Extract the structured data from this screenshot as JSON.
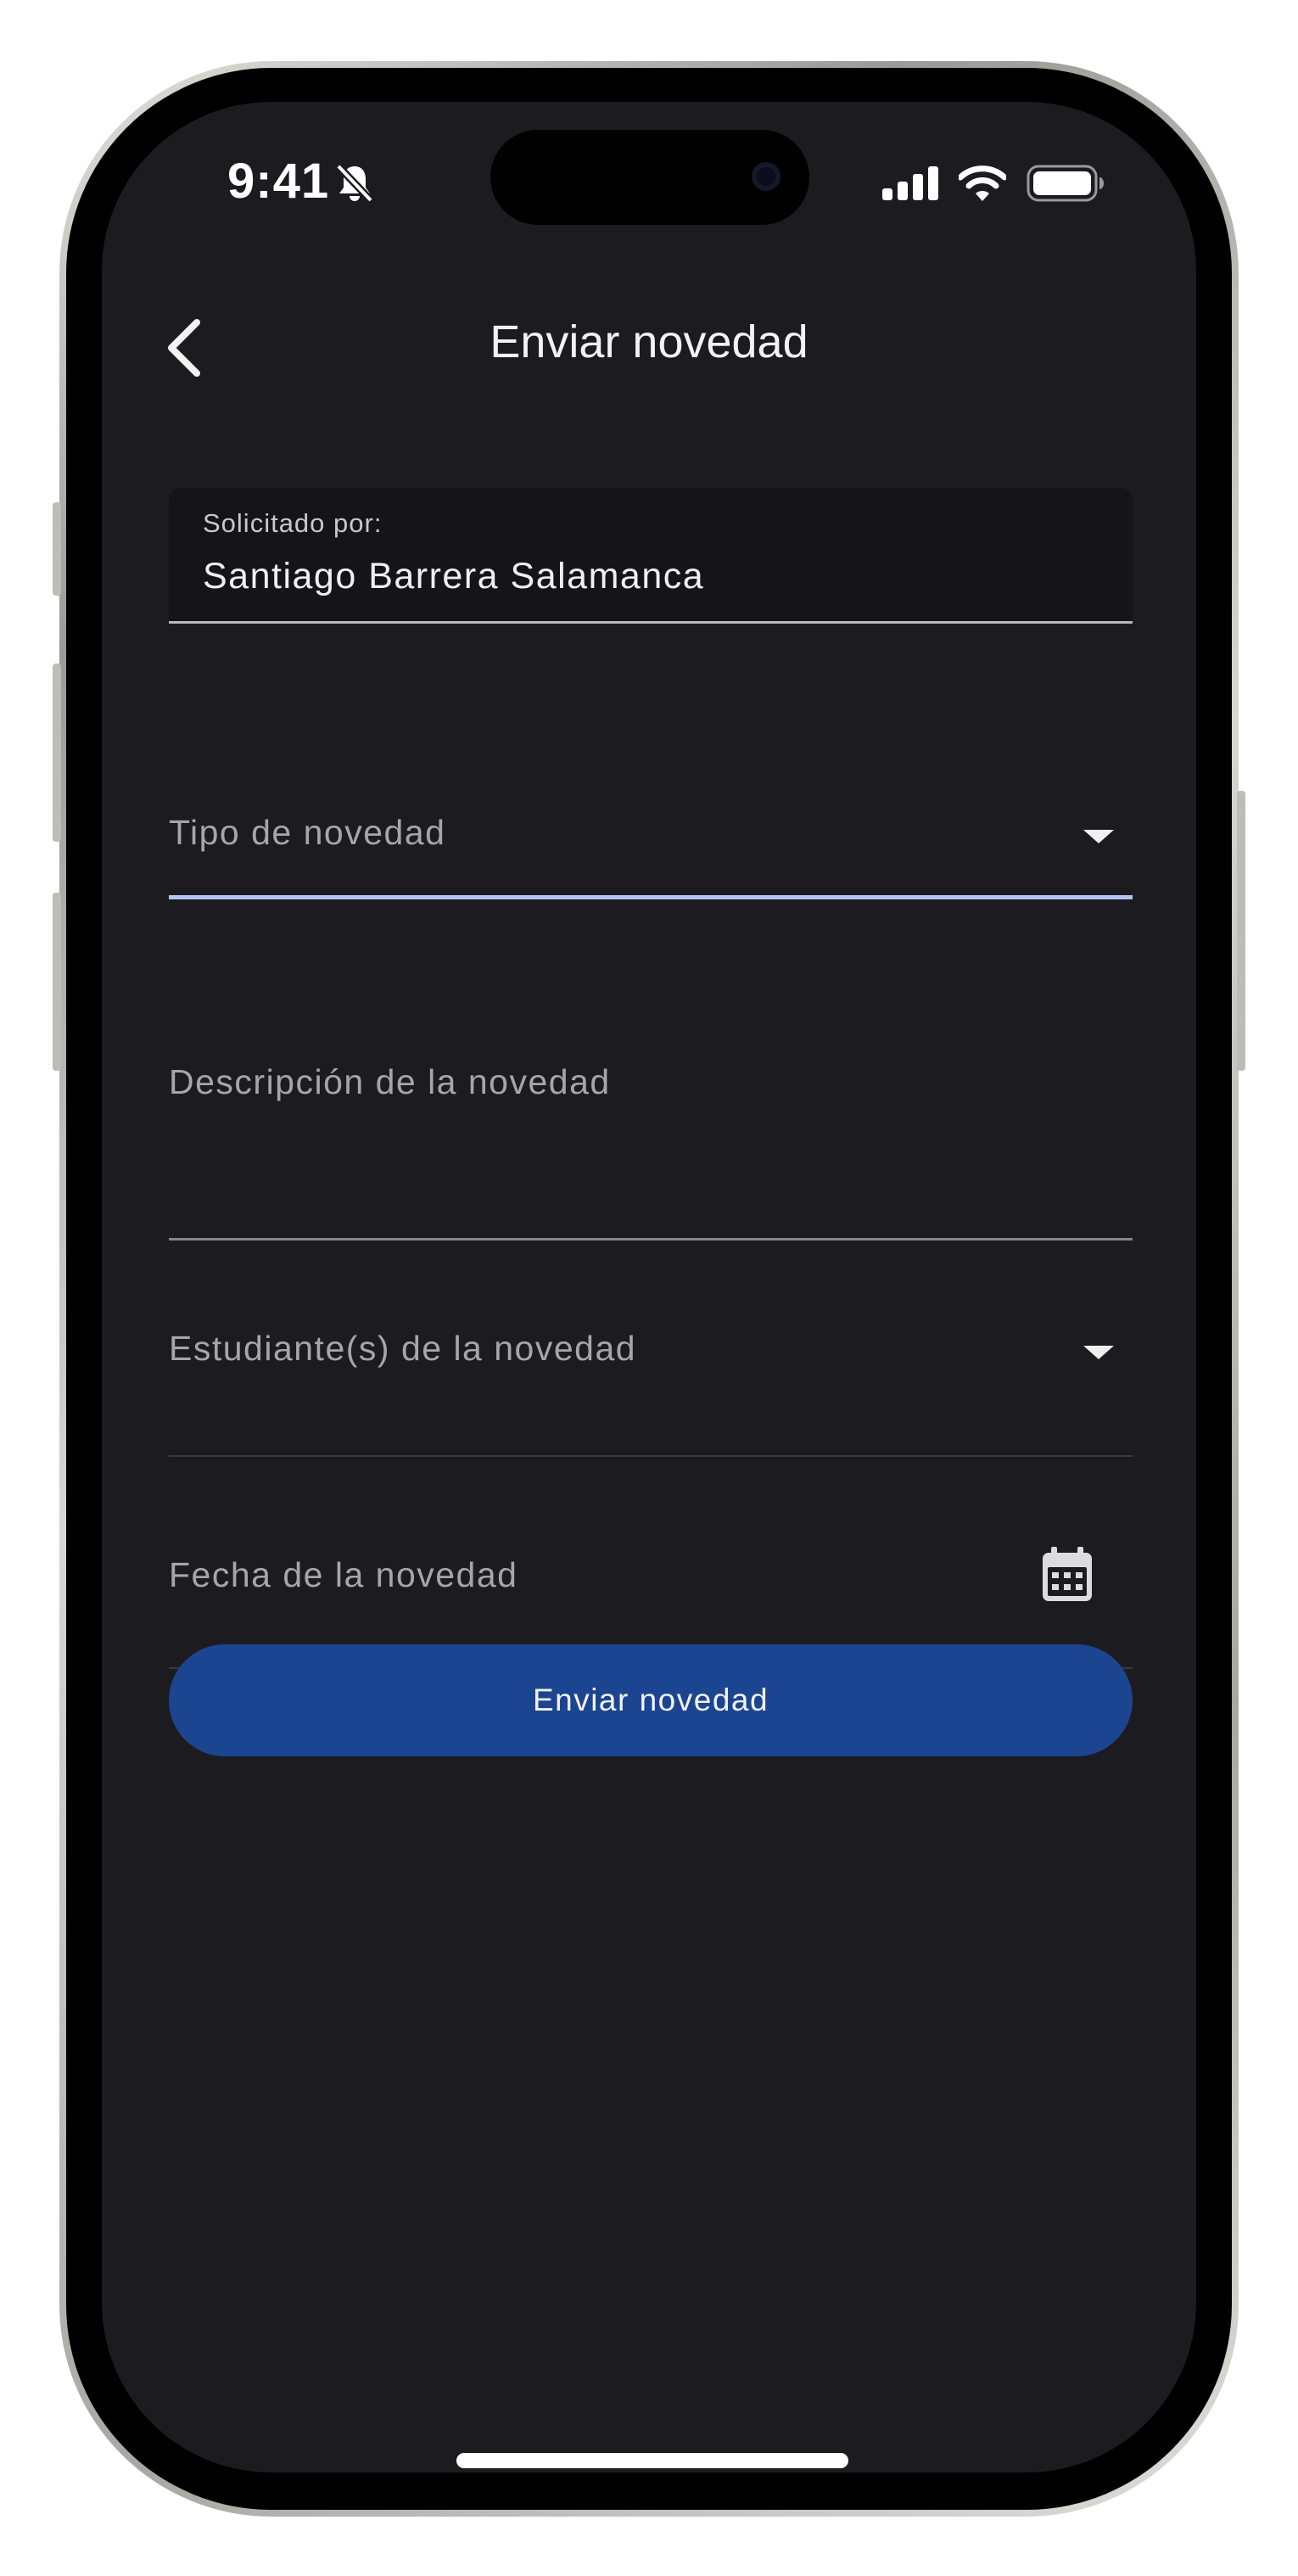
{
  "status_bar": {
    "time": "9:41",
    "icons": [
      "bell-slash-icon",
      "signal-icon",
      "wifi-icon",
      "battery-icon"
    ]
  },
  "header": {
    "title": "Enviar novedad",
    "back_icon": "chevron-left-icon"
  },
  "form": {
    "requested_by": {
      "label": "Solicitado por:",
      "value": "Santiago Barrera Salamanca"
    },
    "type": {
      "placeholder": "Tipo de novedad",
      "icon": "caret-down-icon"
    },
    "description": {
      "placeholder": "Descripción de la novedad"
    },
    "students": {
      "placeholder": "Estudiante(s) de la novedad",
      "icon": "caret-down-icon"
    },
    "date": {
      "placeholder": "Fecha de la novedad",
      "icon": "calendar-icon"
    },
    "submit_label": "Enviar novedad"
  },
  "colors": {
    "background": "#1c1c20",
    "accent_button": "#1c4591",
    "focus_underline": "#b2c5f2"
  }
}
